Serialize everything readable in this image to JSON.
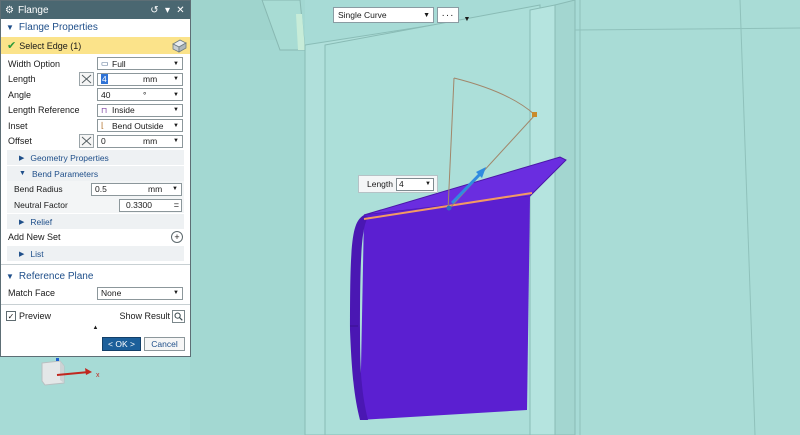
{
  "selection_bar": {
    "filter_value": "Single Curve",
    "more_label": "···"
  },
  "viewport": {
    "length_tip_label": "Length",
    "length_tip_value": "4",
    "triad_x_label": "x"
  },
  "dialog": {
    "title": "Flange",
    "sections": {
      "flange_properties": "Flange Properties",
      "reference_plane": "Reference Plane"
    },
    "select_edge": "Select Edge (1)",
    "fields": {
      "width_option": {
        "label": "Width Option",
        "value": "Full"
      },
      "length": {
        "label": "Length",
        "value": "4",
        "unit": "mm"
      },
      "angle": {
        "label": "Angle",
        "value": "40",
        "unit": "°"
      },
      "length_reference": {
        "label": "Length Reference",
        "value": "Inside"
      },
      "inset": {
        "label": "Inset",
        "value": "Bend Outside"
      },
      "offset": {
        "label": "Offset",
        "value": "0",
        "unit": "mm"
      }
    },
    "geometry_properties": "Geometry Properties",
    "bend_parameters": {
      "title": "Bend Parameters",
      "bend_radius": {
        "label": "Bend Radius",
        "value": "0.5",
        "unit": "mm"
      },
      "neutral_factor": {
        "label": "Neutral Factor",
        "value": "0.3300"
      }
    },
    "relief": "Relief",
    "add_new_set": "Add New Set",
    "list": "List",
    "match_face": {
      "label": "Match Face",
      "value": "None"
    },
    "preview_label": "Preview",
    "show_result_label": "Show Result",
    "ok_label": "< OK >",
    "cancel_label": "Cancel"
  },
  "colors": {
    "viewport_bg": "#a6dad5",
    "titlebar": "#4a6771",
    "section_text": "#1f4f8a",
    "selected_row": "#fbe38a",
    "flange_purple": "#5d1fd0",
    "edge_highlight": "#f39a63",
    "ok_button": "#1c5f9a"
  },
  "icons": {
    "gear": "gear-icon",
    "reset": "reset-icon",
    "collapse": "collapse-icon",
    "close": "close-icon",
    "check": "check-icon",
    "edge_select": "edge-select-icon",
    "clear": "clear-x-icon",
    "magnifier": "magnifier-icon"
  }
}
